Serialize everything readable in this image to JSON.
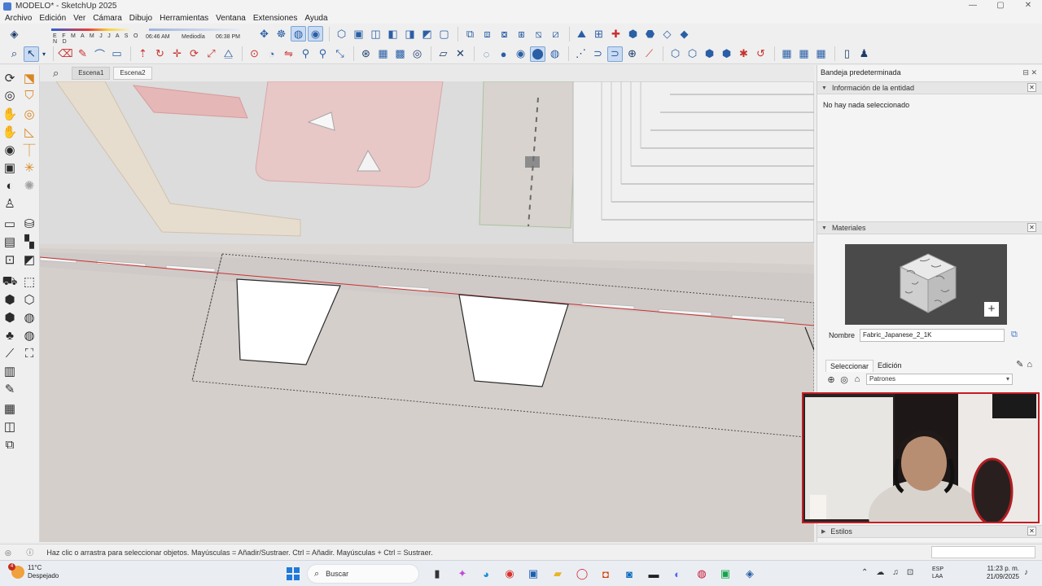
{
  "window": {
    "title": "MODELO* - SketchUp 2025",
    "controls": [
      "—",
      "▢",
      "✕"
    ]
  },
  "menu": [
    "Archivo",
    "Edición",
    "Ver",
    "Cámara",
    "Dibujo",
    "Herramientas",
    "Ventana",
    "Extensiones",
    "Ayuda"
  ],
  "shadow_settings": {
    "months": "E F M A M J J A S O N D",
    "time_start": "06:46 AM",
    "time_mid": "Mediodía",
    "time_end": "06:38 PM"
  },
  "scenes": {
    "tabs": [
      "Escena1",
      "Escena2"
    ],
    "active": "Escena2"
  },
  "tray": {
    "title": "Bandeja predeterminada",
    "entity_info": {
      "header": "Información de la entidad",
      "message": "No hay nada seleccionado"
    },
    "materials": {
      "header": "Materiales",
      "name_label": "Nombre",
      "name_value": "Fabric_Japanese_2_1K",
      "tab_select": "Seleccionar",
      "tab_edit": "Edición",
      "library": "Patrones"
    },
    "styles": {
      "header": "Estilos"
    }
  },
  "status": {
    "hint": "Haz clic o arrastra para seleccionar objetos. Mayúsculas = Añadir/Sustraer. Ctrl = Añadir. Mayúsculas + Ctrl = Sustraer."
  },
  "taskbar": {
    "weather_badge": "4",
    "temperature": "11°C",
    "condition": "Despejado",
    "search_placeholder": "Buscar",
    "lang_1": "ESP",
    "lang_2": "LAA",
    "time": "11:23 p. m.",
    "date": "21/09/2025"
  },
  "colors": {
    "accent": "#2a5fa6",
    "webcam_border": "#c31d24",
    "section_red": "#c8322f"
  }
}
